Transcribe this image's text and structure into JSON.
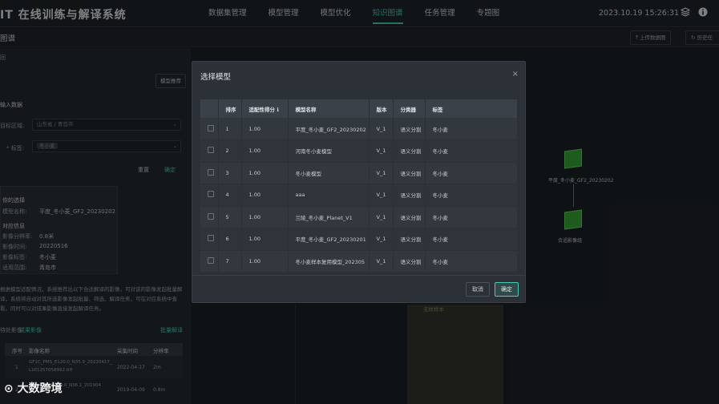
{
  "header": {
    "title": "IT 在线训练与解译系统",
    "nav": [
      "数据集管理",
      "模型管理",
      "模型优化",
      "知识图谱",
      "任务管理",
      "专题图"
    ],
    "active_nav": "知识图谱",
    "datetime": "2023.10.19 15:26:31"
  },
  "subheader": {
    "title": "图谱",
    "upload_btn": "上传数据图",
    "history_btn": "历史任"
  },
  "left_panel": {
    "section_label": "回",
    "model_recommend_btn": "模型推荐",
    "input_title": "输入数据",
    "region_label": "目标区域:",
    "region_value": "山东省 / 青岛市",
    "tag_label": "* 标签:",
    "tag_value": "冬小麦",
    "reset_btn": "重置",
    "confirm_btn": "确定",
    "info": {
      "select_title": "你的选择",
      "model_name_label": "模型名称:",
      "model_name_value": "平度_冬小麦_GF2_20230202",
      "match_title": "对应信息",
      "resolution_label": "影像分辨率:",
      "resolution_value": "0.8米",
      "time_label": "影像时间:",
      "time_value": "20220516",
      "tag_label": "影像标签:",
      "tag_value": "冬小麦",
      "scope_label": "适用范围:",
      "scope_value": "青岛市"
    },
    "desc": "根据模型适配情况，系统推荐出以下合适解译的影像，可对该的影像发起批量解译，系统将自动对其所选影像发起批量、筛选、解译任务，可在对应系统中查看，同时可以对成果影像直接发起解译任务。",
    "tabs": [
      "待处影像",
      "成果影像"
    ],
    "batch_btn": "批量解译",
    "table_headers": [
      "序号",
      "影像名称",
      "采集时间",
      "分辨率"
    ],
    "rows": [
      {
        "no": "1",
        "name": "GF1C_PMS_E120.0_N35.9_20220417_L1E1257058992.tiff",
        "date": "2022-04-17",
        "res": "2m"
      },
      {
        "no": "2",
        "name": "GF2_PMS_E120.0_N36.1_201904",
        "date": "2019-04-09",
        "res": "0.8m"
      }
    ]
  },
  "graph": {
    "node1_label": "平度_冬小麦_GF2_20230202",
    "node2_label": "合适影像组",
    "empty_label": "无样样本"
  },
  "modal": {
    "title": "选择模型",
    "headers": [
      "",
      "排序",
      "适配性得分",
      "模型名称",
      "版本",
      "分类器",
      "标签"
    ],
    "rows": [
      {
        "rank": "1",
        "score": "1.00",
        "name": "平度_冬小麦_GF2_20230202",
        "ver": "V_1",
        "cls": "语义分割",
        "tag": "冬小麦"
      },
      {
        "rank": "2",
        "score": "1.00",
        "name": "河南冬小麦模型",
        "ver": "V_1",
        "cls": "语义分割",
        "tag": "冬小麦"
      },
      {
        "rank": "3",
        "score": "1.00",
        "name": "冬小麦模型",
        "ver": "V_1",
        "cls": "语义分割",
        "tag": "冬小麦"
      },
      {
        "rank": "4",
        "score": "1.00",
        "name": "aaa",
        "ver": "V_1",
        "cls": "语义分割",
        "tag": "冬小麦"
      },
      {
        "rank": "5",
        "score": "1.00",
        "name": "兰陵_冬小麦_Planet_V1",
        "ver": "V_1",
        "cls": "语义分割",
        "tag": "冬小麦"
      },
      {
        "rank": "6",
        "score": "1.00",
        "name": "平度_冬小麦_GF2_20230201",
        "ver": "V_1",
        "cls": "语义分割",
        "tag": "冬小麦"
      },
      {
        "rank": "7",
        "score": "1.00",
        "name": "冬小麦样本复用模型_202305",
        "ver": "V_1",
        "cls": "语义分割",
        "tag": "冬小麦"
      }
    ],
    "cancel_btn": "取消",
    "ok_btn": "确定"
  },
  "watermark": "大数跨境",
  "colors": {
    "accent": "#4bc9b9",
    "node": "#3aa73a"
  }
}
